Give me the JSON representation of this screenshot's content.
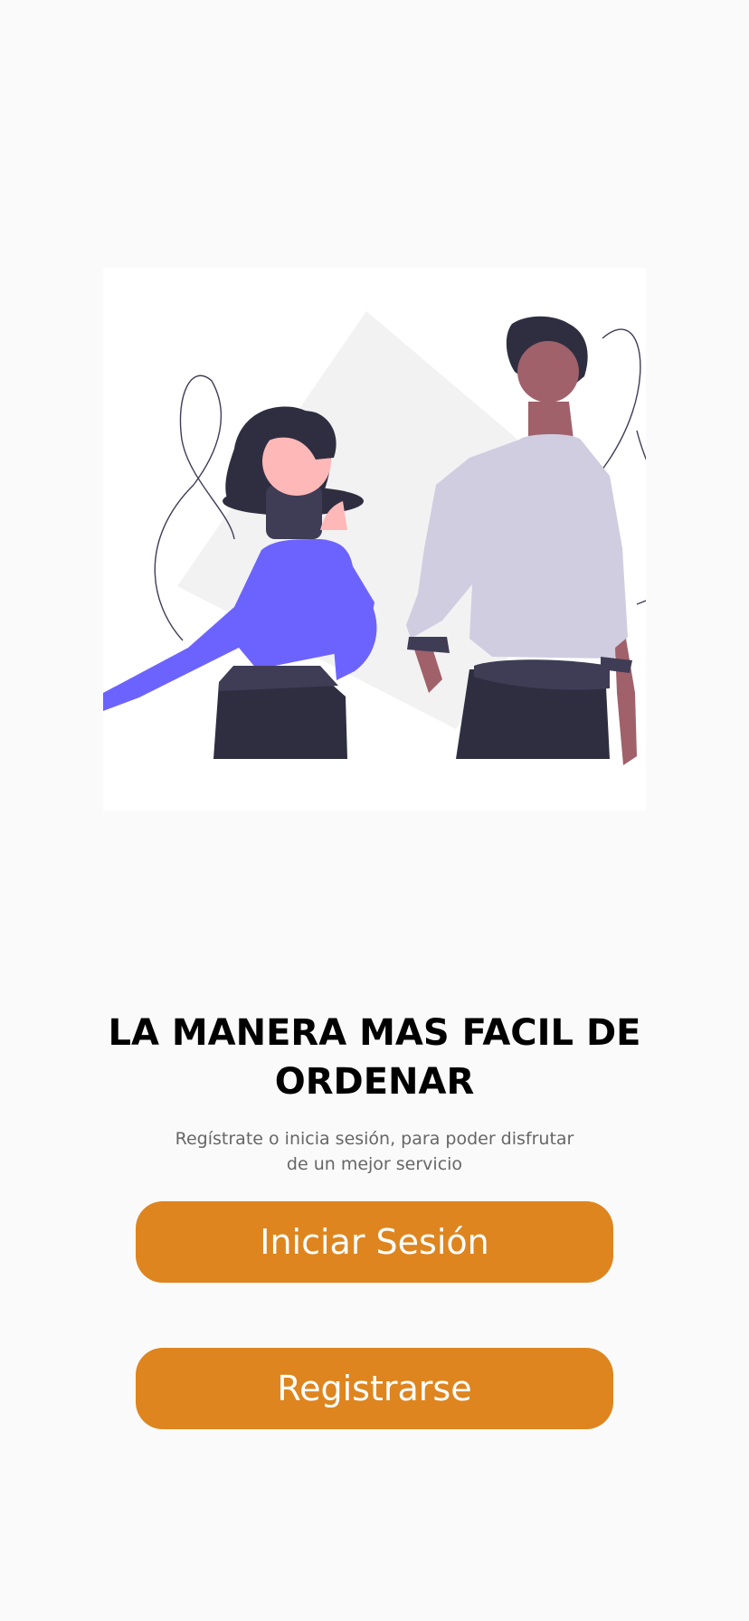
{
  "hero": {
    "illustration": "two-people-illustration"
  },
  "headline": "LA MANERA MAS FACIL DE ORDENAR",
  "subtitle": "Regístrate o inicia sesión, para poder disfrutar de un mejor servicio",
  "buttons": {
    "login_label": "Iniciar Sesión",
    "register_label": "Registrarse"
  },
  "colors": {
    "background": "#fafafa",
    "button": "#de851f",
    "button_text": "#ffffff",
    "headline": "#000000",
    "subtitle": "#666666",
    "accent_purple": "#6c63ff"
  }
}
